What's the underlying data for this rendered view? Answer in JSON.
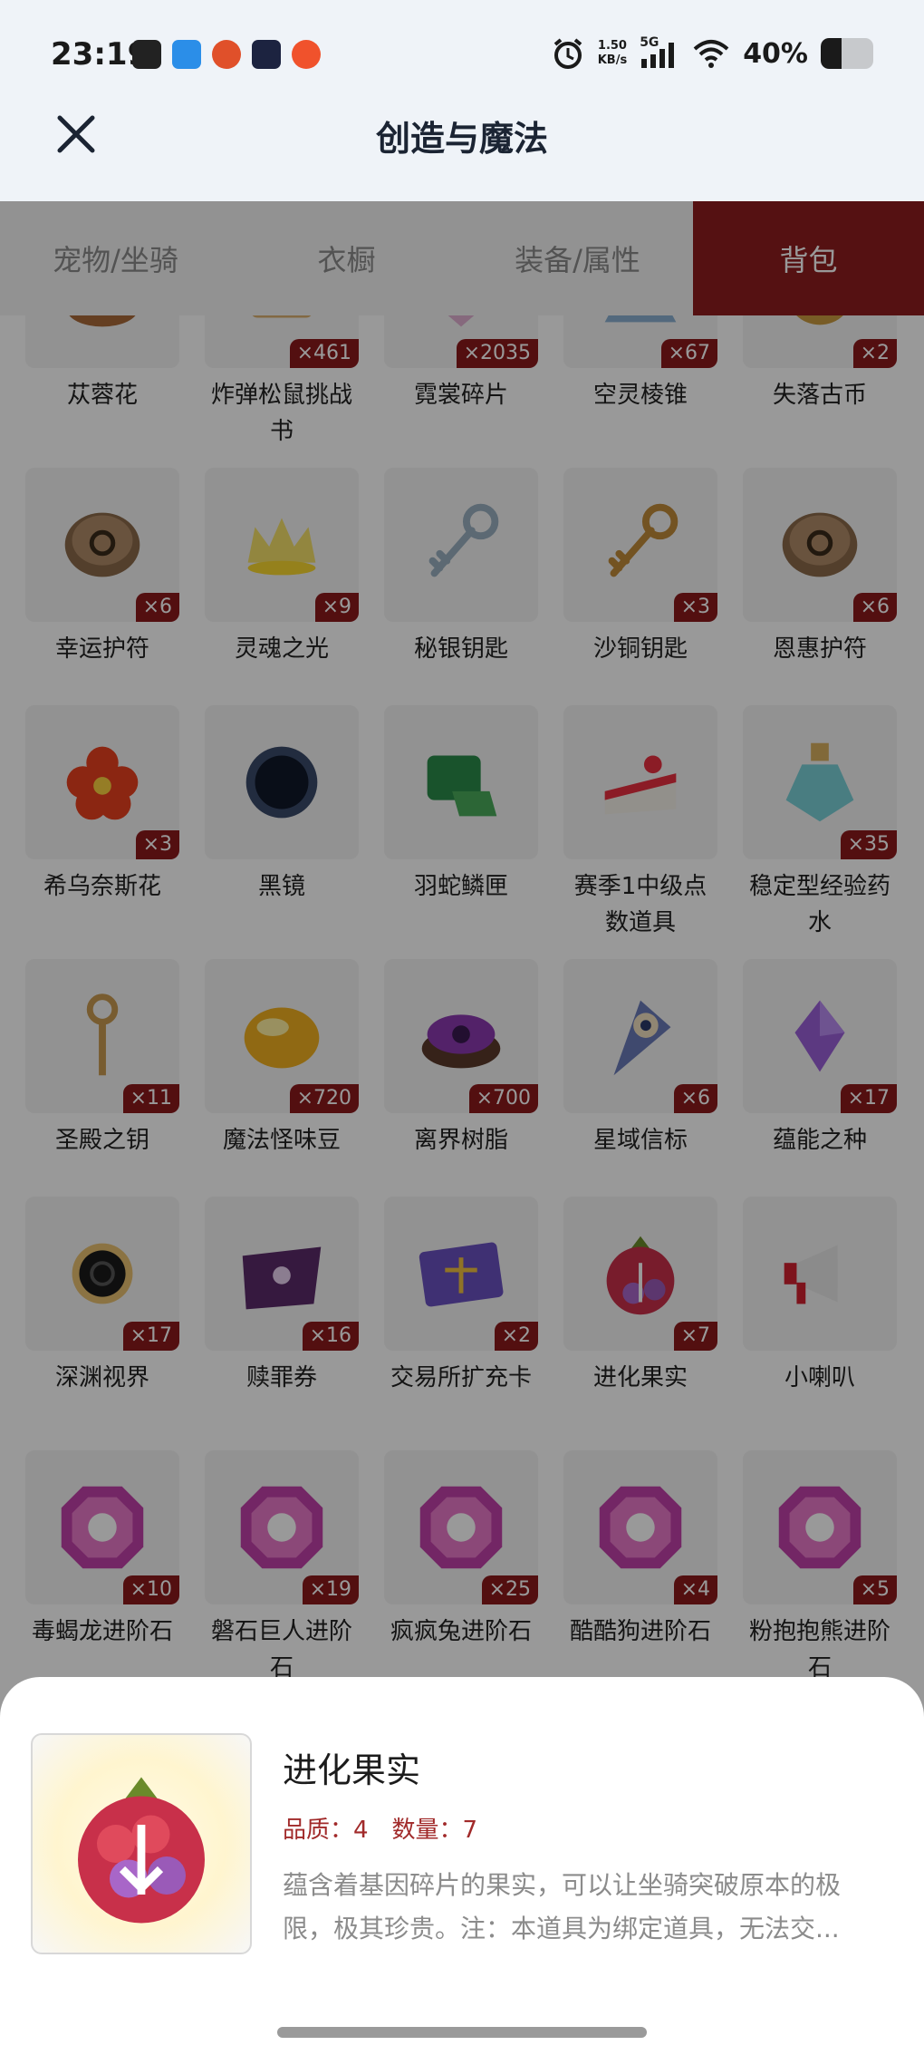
{
  "status_bar": {
    "time": "23:19",
    "net_speed_value": "1.50",
    "net_speed_unit": "KB/s",
    "network": "5G",
    "battery_text": "40%",
    "battery_level": 0.4
  },
  "header": {
    "title": "创造与魔法",
    "close_icon": "close-icon"
  },
  "tabs": [
    {
      "label": "宠物/坐骑",
      "active": false
    },
    {
      "label": "衣橱",
      "active": false
    },
    {
      "label": "装备/属性",
      "active": false
    },
    {
      "label": "背包",
      "active": true
    }
  ],
  "inventory": [
    {
      "name": "苁蓉花",
      "count": "",
      "icon": "herb-icon"
    },
    {
      "name": "炸弹松鼠挑战书",
      "count": "×461",
      "icon": "scroll-icon"
    },
    {
      "name": "霓裳碎片",
      "count": "×2035",
      "icon": "fragment-icon"
    },
    {
      "name": "空灵棱锥",
      "count": "×67",
      "icon": "pyramid-icon"
    },
    {
      "name": "失落古币",
      "count": "×2",
      "icon": "coin-icon"
    },
    {
      "name": "幸运护符",
      "count": "×6",
      "icon": "stone-amulet-icon"
    },
    {
      "name": "灵魂之光",
      "count": "×9",
      "icon": "crown-icon"
    },
    {
      "name": "秘银钥匙",
      "count": "",
      "icon": "silver-key-icon"
    },
    {
      "name": "沙铜钥匙",
      "count": "×3",
      "icon": "bronze-key-icon"
    },
    {
      "name": "恩惠护符",
      "count": "×6",
      "icon": "stone-amulet-icon"
    },
    {
      "name": "希乌奈斯花",
      "count": "×3",
      "icon": "flower-icon"
    },
    {
      "name": "黑镜",
      "count": "",
      "icon": "black-mirror-icon"
    },
    {
      "name": "羽蛇鳞匣",
      "count": "",
      "icon": "scale-box-icon"
    },
    {
      "name": "赛季1中级点数道具",
      "count": "",
      "icon": "cake-icon"
    },
    {
      "name": "稳定型经验药水",
      "count": "×35",
      "icon": "potion-icon"
    },
    {
      "name": "圣殿之钥",
      "count": "×11",
      "icon": "temple-key-icon"
    },
    {
      "name": "魔法怪味豆",
      "count": "×720",
      "icon": "bean-icon"
    },
    {
      "name": "离界树脂",
      "count": "×700",
      "icon": "resin-icon"
    },
    {
      "name": "星域信标",
      "count": "×6",
      "icon": "beacon-icon"
    },
    {
      "name": "蕴能之种",
      "count": "×17",
      "icon": "crystal-icon"
    },
    {
      "name": "深渊视界",
      "count": "×17",
      "icon": "abyss-icon"
    },
    {
      "name": "赎罪券",
      "count": "×16",
      "icon": "ticket-icon"
    },
    {
      "name": "交易所扩充卡",
      "count": "×2",
      "icon": "card-icon"
    },
    {
      "name": "进化果实",
      "count": "×7",
      "icon": "berry-icon"
    },
    {
      "name": "小喇叭",
      "count": "",
      "icon": "megaphone-icon"
    },
    {
      "name": "毒蝎龙进阶石",
      "count": "×10",
      "icon": "gem-icon"
    },
    {
      "name": "磐石巨人进阶石",
      "count": "×19",
      "icon": "gem-icon"
    },
    {
      "name": "疯疯兔进阶石",
      "count": "×25",
      "icon": "gem-icon"
    },
    {
      "name": "酷酷狗进阶石",
      "count": "×4",
      "icon": "gem-icon"
    },
    {
      "name": "粉抱抱熊进阶石",
      "count": "×5",
      "icon": "gem-icon"
    },
    {
      "name": "",
      "count": "",
      "icon": "blue-berry-icon"
    },
    {
      "name": "",
      "count": "",
      "icon": "blue-berry-icon"
    },
    {
      "name": "",
      "count": "",
      "icon": "gem-icon"
    },
    {
      "name": "",
      "count": "",
      "icon": "gem-icon"
    },
    {
      "name": "",
      "count": "",
      "icon": "gem-icon"
    }
  ],
  "detail": {
    "name": "进化果实",
    "quality_label": "品质：4",
    "quantity_label": "数量：7",
    "description": "蕴含着基因碎片的果实，可以让坐骑突破原本的极限，极其珍贵。注：本道具为绑定道具，无法交...",
    "icon": "berry-icon"
  },
  "colors": {
    "accent": "#8e1d1f",
    "badge": "#8a1a1c",
    "quality_text": "#a12a2a"
  }
}
